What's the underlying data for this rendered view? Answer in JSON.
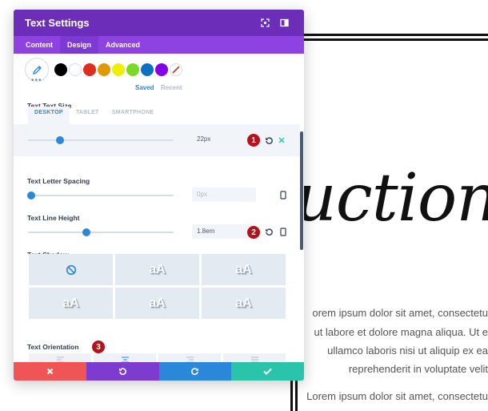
{
  "background": {
    "title_text": "uction",
    "paragraphs": [
      "orem ipsum dolor sit amet, consectetu",
      "ut labore et dolore magna aliqua. Ut e",
      "ullamco laboris nisi ut aliquip ex ea",
      "reprehenderit in voluptate velit",
      "Lorem ipsum dolor sit amet, consectetu"
    ]
  },
  "modal": {
    "title": "Text Settings",
    "header_icons": [
      "fullscreen-icon",
      "split-view-icon"
    ],
    "tabs": [
      {
        "label": "Content",
        "active": false
      },
      {
        "label": "Design",
        "active": true
      },
      {
        "label": "Advanced",
        "active": false
      }
    ],
    "colors": {
      "swatches": [
        "#000000",
        "#ffffff",
        "#e02b20",
        "#e09900",
        "#edf000",
        "#7cda24",
        "#0c71c3",
        "#8300e9"
      ],
      "saved_label": "Saved",
      "recent_label": "Recent"
    },
    "text_size": {
      "label": "Text Text Size",
      "device_tabs": [
        "DESKTOP",
        "TABLET",
        "SMARTPHONE"
      ],
      "active_device": "DESKTOP",
      "value": "22px",
      "slider_fraction": 0.22
    },
    "letter_spacing": {
      "label": "Text Letter Spacing",
      "value": "0px",
      "slider_fraction": 0.02
    },
    "line_height": {
      "label": "Text Line Height",
      "value": "1.8em",
      "slider_fraction": 0.4
    },
    "text_shadow": {
      "label": "Text Shadow",
      "preview_text": "aA",
      "options": 6
    },
    "orientation": {
      "label": "Text Orientation",
      "options": [
        "justify-left",
        "center",
        "right",
        "justify"
      ]
    },
    "badges": [
      "1",
      "2",
      "3"
    ],
    "footer": {
      "colors": {
        "cancel": "#ef5555",
        "undo": "#7e3bd0",
        "redo": "#2b87da",
        "save": "#29c4a9"
      }
    }
  }
}
